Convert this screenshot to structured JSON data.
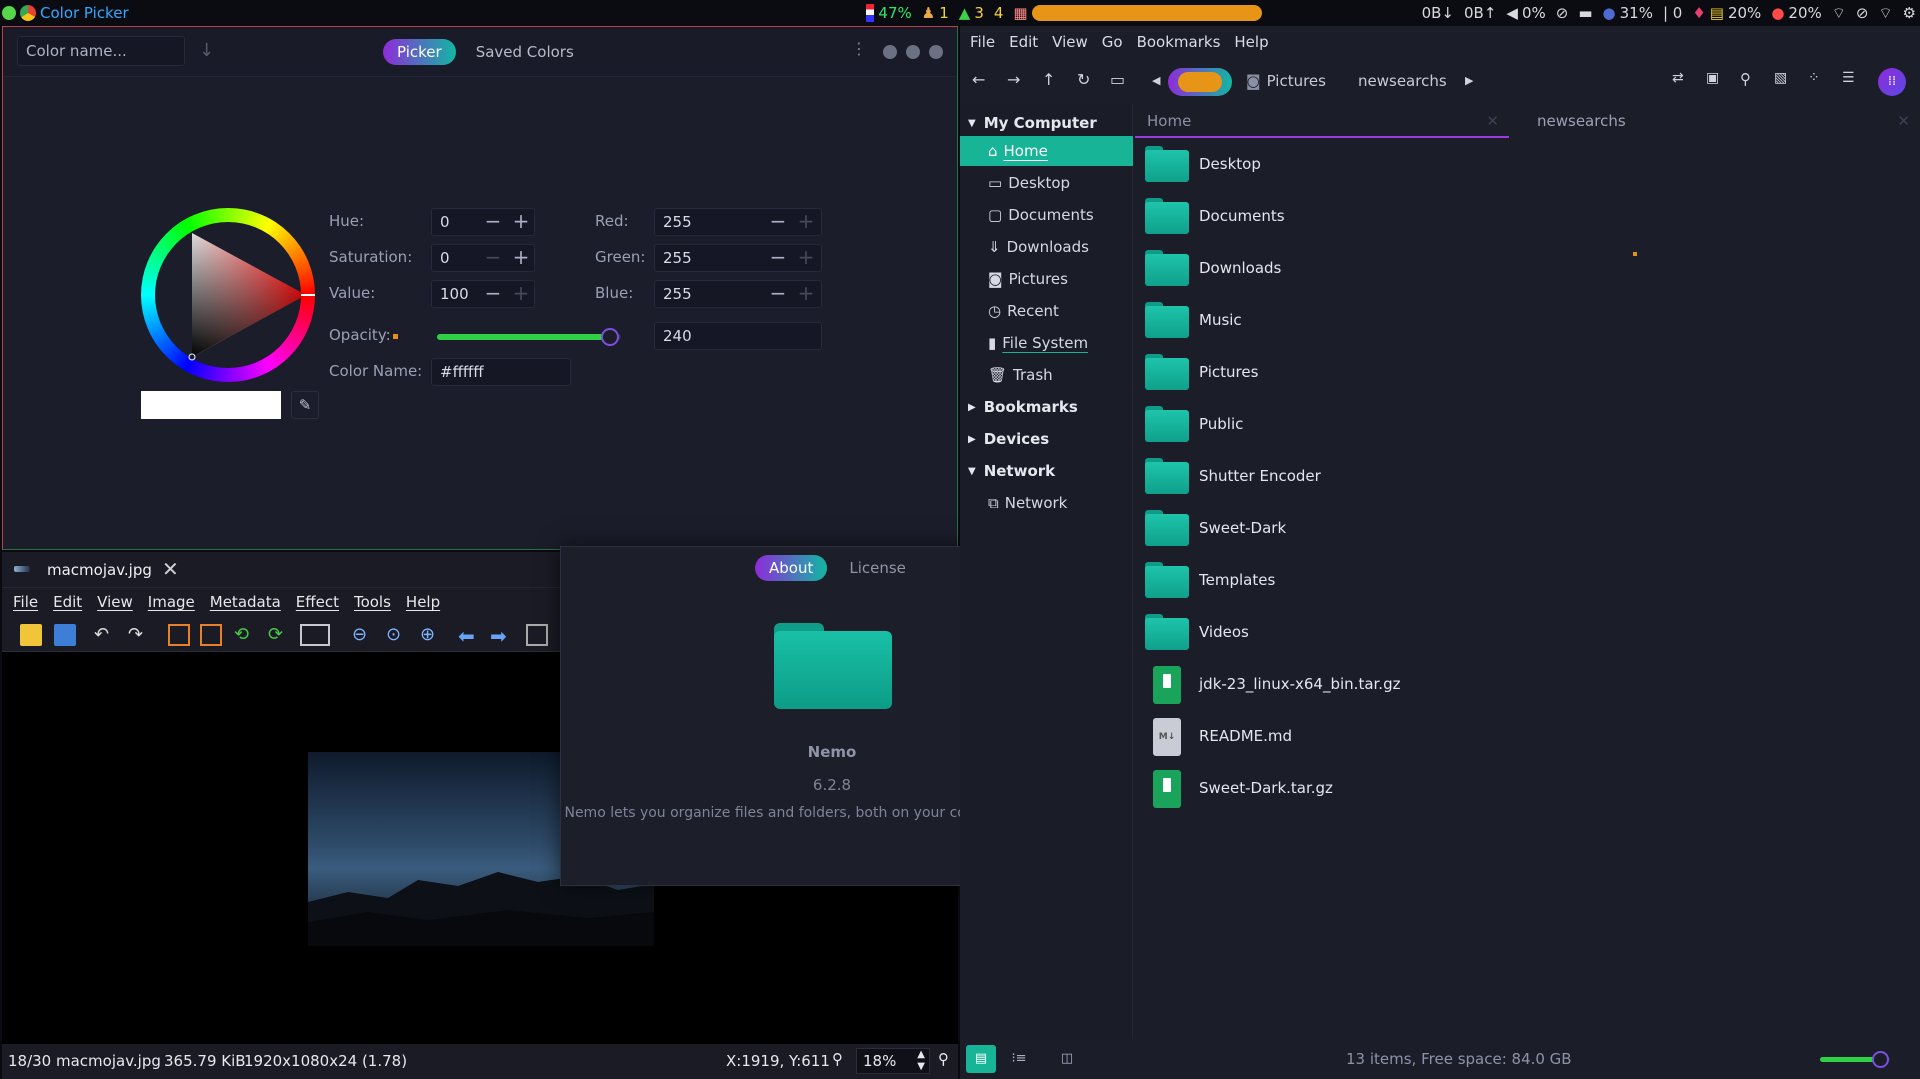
{
  "topbar": {
    "app_title": "Color Picker",
    "battery1": "47%",
    "ws1": "1",
    "ws2": "3",
    "ws3": "4",
    "net_down": "0B↓",
    "net_up": "0B↑",
    "volume": "0%",
    "battery2": "31%",
    "sep": "| 0",
    "cpu": "20%",
    "temp": "20%"
  },
  "color_picker": {
    "name_placeholder": "Color name...",
    "tab_picker": "Picker",
    "tab_saved": "Saved Colors",
    "hue_label": "Hue:",
    "hue_value": "0",
    "saturation_label": "Saturation:",
    "saturation_value": "0",
    "value_label": "Value:",
    "value_value": "100",
    "red_label": "Red:",
    "red_value": "255",
    "green_label": "Green:",
    "green_value": "255",
    "blue_label": "Blue:",
    "blue_value": "255",
    "opacity_label": "Opacity:",
    "opacity_value": "240",
    "opacity_fraction": 0.94,
    "colorname_label": "Color Name:",
    "colorname_value": "#ffffff",
    "current_color": "#ffffff"
  },
  "image_viewer": {
    "tab_title": "macmojav.jpg",
    "menus": [
      "File",
      "Edit",
      "View",
      "Image",
      "Metadata",
      "Effect",
      "Tools",
      "Help"
    ],
    "status_index": "18/30",
    "status_file": "macmojav.jpg",
    "status_size": "365.79 KiB",
    "status_dims": "1920x1080x24 (1.78)",
    "status_coords": "X:1919, Y:611",
    "zoom": "18%"
  },
  "about_dialog": {
    "tab_about": "About",
    "tab_license": "License",
    "app_name": "Nemo",
    "version": "6.2.8",
    "description": "Nemo lets you organize files and folders, both on your computer and online."
  },
  "nemo": {
    "menus": [
      "File",
      "Edit",
      "View",
      "Go",
      "Bookmarks",
      "Help"
    ],
    "path": [
      "Pictures",
      "newsearchs"
    ],
    "sidebar": {
      "my_computer": "My Computer",
      "items": [
        {
          "label": "Home",
          "icon": "home-icon"
        },
        {
          "label": "Desktop",
          "icon": "desktop-icon"
        },
        {
          "label": "Documents",
          "icon": "documents-icon"
        },
        {
          "label": "Downloads",
          "icon": "downloads-icon"
        },
        {
          "label": "Pictures",
          "icon": "pictures-icon"
        },
        {
          "label": "Recent",
          "icon": "recent-icon"
        },
        {
          "label": "File System",
          "icon": "drive-icon"
        },
        {
          "label": "Trash",
          "icon": "trash-icon"
        }
      ],
      "bookmarks": "Bookmarks",
      "devices": "Devices",
      "network": "Network",
      "network_item": "Network"
    },
    "tabs": [
      "Home",
      "newsearchs"
    ],
    "files": [
      {
        "name": "Desktop",
        "type": "folder"
      },
      {
        "name": "Documents",
        "type": "folder"
      },
      {
        "name": "Downloads",
        "type": "folder"
      },
      {
        "name": "Music",
        "type": "folder"
      },
      {
        "name": "Pictures",
        "type": "folder"
      },
      {
        "name": "Public",
        "type": "folder"
      },
      {
        "name": "Shutter Encoder",
        "type": "folder"
      },
      {
        "name": "Sweet-Dark",
        "type": "folder"
      },
      {
        "name": "Templates",
        "type": "folder"
      },
      {
        "name": "Videos",
        "type": "folder"
      },
      {
        "name": "jdk-23_linux-x64_bin.tar.gz",
        "type": "archive"
      },
      {
        "name": "README.md",
        "type": "markdown"
      },
      {
        "name": "Sweet-Dark.tar.gz",
        "type": "archive"
      }
    ],
    "status": "13 items, Free space: 84.0 GB",
    "zoom_level": 0.85
  },
  "colors": {
    "accent_teal": "#17b497",
    "accent_purple": "#8e2bd8",
    "folder": "#17b8a0"
  }
}
